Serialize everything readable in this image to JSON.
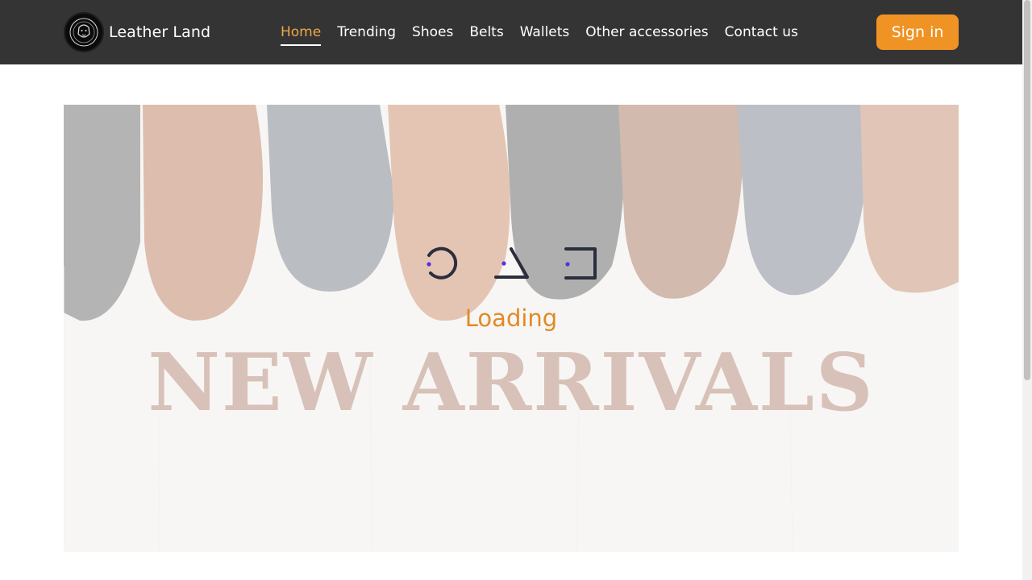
{
  "brand": {
    "name": "Leather Land",
    "logo_icon": "lion-crest-logo-icon"
  },
  "nav": {
    "items": [
      {
        "label": "Home",
        "active": true
      },
      {
        "label": "Trending",
        "active": false
      },
      {
        "label": "Shoes",
        "active": false
      },
      {
        "label": "Belts",
        "active": false
      },
      {
        "label": "Wallets",
        "active": false
      },
      {
        "label": "Other accessories",
        "active": false
      },
      {
        "label": "Contact us",
        "active": false
      }
    ],
    "signin_label": "Sign in"
  },
  "hero": {
    "title": "NEW ARRIVALS"
  },
  "loader": {
    "text": "Loading",
    "shapes": [
      "circle-icon",
      "triangle-icon",
      "square-icon"
    ]
  },
  "colors": {
    "nav_bg": "#343434",
    "accent": "#ef9324",
    "active_link": "#f0a64a",
    "loader_dot": "#5b2ee0",
    "loader_stroke": "#2b2f3d"
  }
}
